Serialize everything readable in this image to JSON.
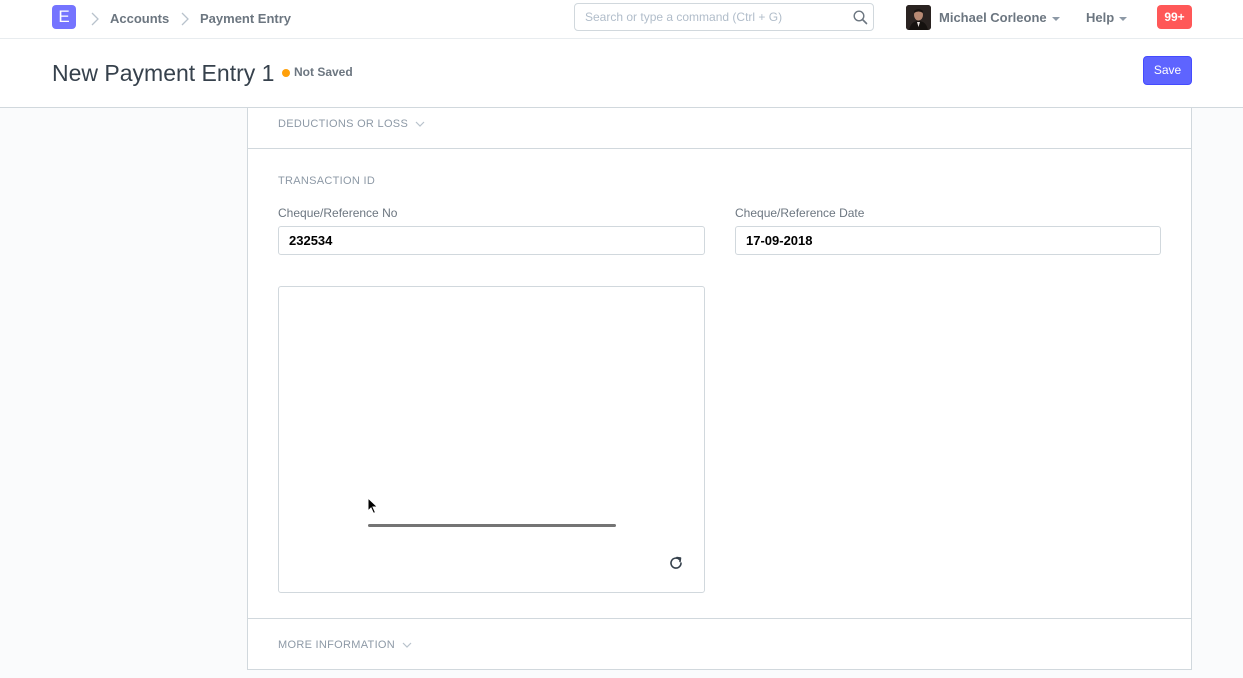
{
  "navbar": {
    "logo_letter": "E",
    "breadcrumbs": [
      "Accounts",
      "Payment Entry"
    ],
    "search_placeholder": "Search or type a command (Ctrl + G)",
    "user_name": "Michael Corleone",
    "help_label": "Help",
    "notifications": "99+"
  },
  "page": {
    "title": "New Payment Entry 1",
    "status": "Not Saved",
    "status_color": "#ffa00a",
    "save_label": "Save",
    "accent_color": "#5e64ff"
  },
  "form": {
    "deductions_section": "DEDUCTIONS OR LOSS",
    "transaction_section": "TRANSACTION ID",
    "reference_no": {
      "label": "Cheque/Reference No",
      "value": "232534"
    },
    "reference_date": {
      "label": "Cheque/Reference Date",
      "value": "17-09-2018"
    },
    "more_info_section": "MORE INFORMATION"
  },
  "icons": {
    "search": "search-icon",
    "chevron": "chevron-down-icon",
    "refresh": "refresh-icon",
    "cursor": "mouse-pointer-icon"
  }
}
